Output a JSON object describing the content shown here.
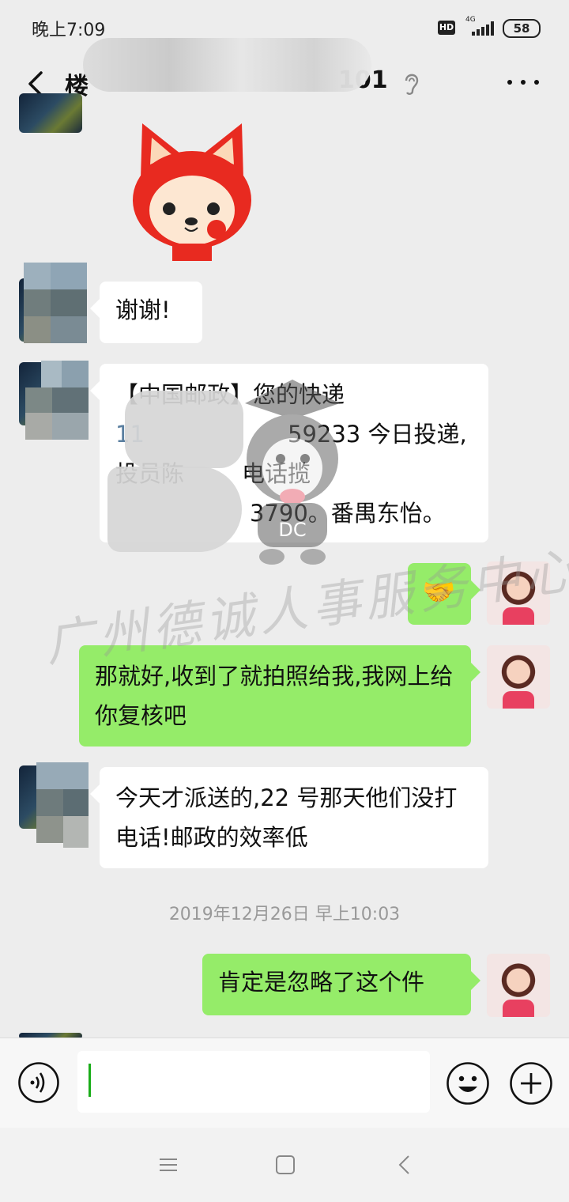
{
  "status_bar": {
    "time": "晚上7:09",
    "hd_label": "HD",
    "network": "4G",
    "battery": "58"
  },
  "header": {
    "title_prefix": "楼",
    "title_suffix": "101",
    "back_icon": "chevron-left-icon",
    "ear_icon": "ear-icon",
    "more_icon": "more-dots-icon"
  },
  "messages": [
    {
      "side": "left",
      "type": "text",
      "text": "谢谢!"
    },
    {
      "side": "left",
      "type": "text",
      "lines": [
        "【中国邮政】您的快递",
        "11",
        "59233 今日投递,揽",
        "投员陈",
        "电话",
        "3790。番禺东怡。"
      ]
    },
    {
      "side": "right",
      "type": "emoji",
      "text": "🤝"
    },
    {
      "side": "right",
      "type": "text",
      "text": "那就好,收到了就拍照给我,我网上给你复核吧"
    },
    {
      "side": "left",
      "type": "text",
      "text": "今天才派送的,22 号那天他们没打电话!邮政的效率低"
    },
    {
      "side": "right",
      "type": "text",
      "text": "肯定是忽略了这个件"
    }
  ],
  "timestamp": "2019年12月26日 早上10:03",
  "watermark": "广州德诚人事服务中心",
  "sticker_text": "DC",
  "input": {
    "value": "",
    "voice_icon": "voice-icon",
    "emoji_icon": "emoji-icon",
    "plus_icon": "plus-icon"
  },
  "colors": {
    "background": "#ededed",
    "bubble_right": "#95ec69",
    "bubble_left": "#ffffff"
  }
}
